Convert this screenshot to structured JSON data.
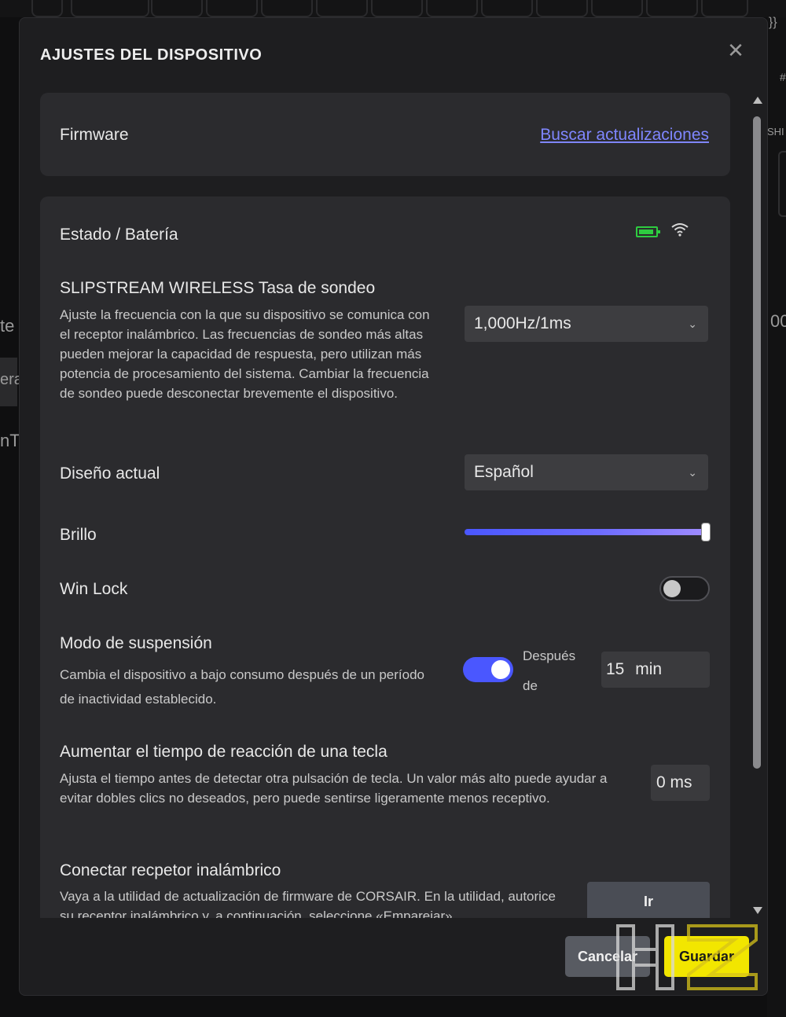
{
  "background": {
    "fragments": [
      "te",
      "era",
      "nT",
      "}}",
      "#",
      "SHI",
      "00"
    ]
  },
  "dialog": {
    "title": "AJUSTES DEL DISPOSITIVO",
    "close_icon": "close-icon"
  },
  "firmware": {
    "label": "Firmware",
    "link": "Buscar actualizaciones"
  },
  "status": {
    "label": "Estado / Batería",
    "battery_icon": "battery-icon",
    "battery_color": "#2ecc40",
    "wifi_icon": "wifi-icon"
  },
  "polling": {
    "title": "SLIPSTREAM WIRELESS Tasa de sondeo",
    "description": "Ajuste la frecuencia con la que su dispositivo se comunica con el receptor inalámbrico. Las frecuencias de sondeo más altas pueden mejorar la capacidad de respuesta, pero utilizan más potencia de procesamiento del sistema. Cambiar la frecuencia de sondeo puede desconectar brevemente el dispositivo.",
    "value": "1,000Hz/1ms"
  },
  "layout": {
    "label": "Diseño actual",
    "value": "Español"
  },
  "brightness": {
    "label": "Brillo",
    "level": 1.0,
    "accent": "#4a57ff"
  },
  "winlock": {
    "label": "Win Lock",
    "enabled": false
  },
  "sleep": {
    "title": "Modo de suspensión",
    "description": "Cambia el dispositivo a bajo consumo después de un período de inactividad establecido.",
    "enabled": true,
    "after_label_1": "Después",
    "after_label_2": "de",
    "value": "15",
    "unit": "min"
  },
  "debounce": {
    "title": "Aumentar el tiempo de reacción de una tecla",
    "description": "Ajusta el tiempo antes de detectar otra pulsación de tecla. Un valor más alto puede ayudar a evitar dobles clics no deseados, pero puede sentirse ligeramente menos receptivo.",
    "value": "0 ms"
  },
  "receiver": {
    "title": "Conectar recpetor inalámbrico",
    "description": "Vaya a la utilidad de actualización de firmware de CORSAIR. En la utilidad, autorice su receptor inalámbrico y, a continuación, seleccione «Emparejar»",
    "button": "Ir"
  },
  "footer": {
    "cancel": "Cancelar",
    "save": "Guardar",
    "save_color": "#f2e600"
  },
  "watermark": {
    "text": "HZ"
  }
}
